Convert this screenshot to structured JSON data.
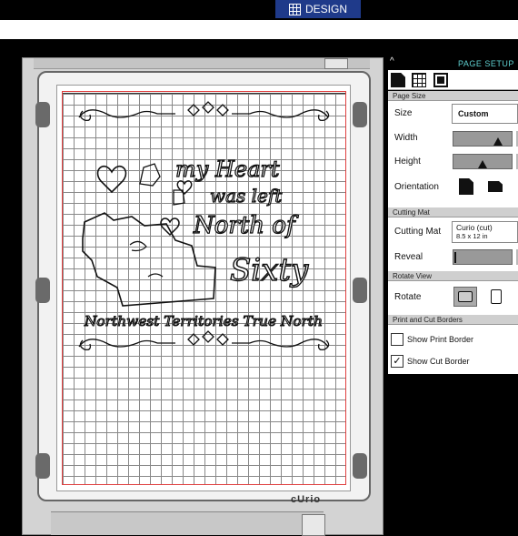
{
  "toolbar": {
    "design_label": "DESIGN"
  },
  "panel": {
    "collapse_glyph": "^",
    "title": "PAGE SETUP",
    "page_size": {
      "header": "Page Size",
      "size_label": "Size",
      "size_value": "Custom",
      "width_label": "Width",
      "height_label": "Height",
      "orientation_label": "Orientation"
    },
    "cutting_mat": {
      "header": "Cutting Mat",
      "mat_label": "Cutting Mat",
      "mat_value": "Curio (cut)",
      "mat_sub": "8.5 x 12 in",
      "reveal_label": "Reveal"
    },
    "rotate_view": {
      "header": "Rotate View",
      "rotate_label": "Rotate"
    },
    "borders": {
      "header": "Print and Cut Borders",
      "print_border_label": "Show Print Border",
      "print_border_checked": false,
      "cut_border_label": "Show Cut Border",
      "cut_border_checked": true,
      "check_mark": "✓"
    }
  },
  "machine": {
    "brand": "cUrio"
  },
  "design": {
    "line1": "my Heart",
    "line2": "was left",
    "line3": "North of",
    "line4": "Sixty",
    "footer_text": "Northwest Territories True North"
  }
}
